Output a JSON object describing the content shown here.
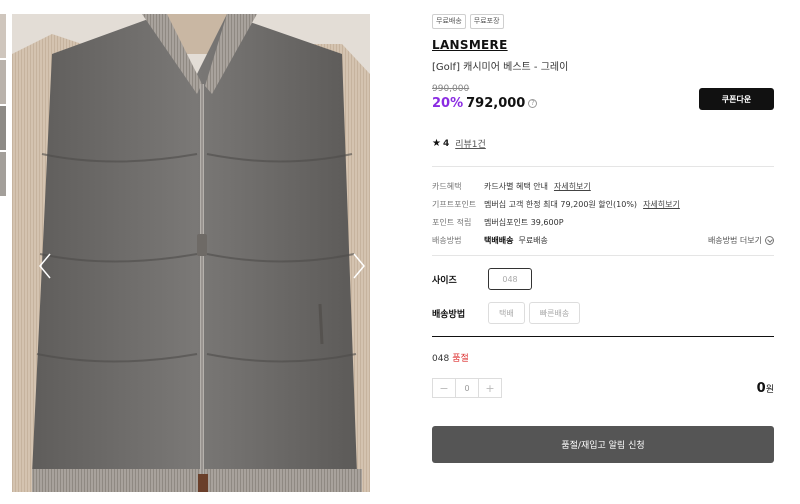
{
  "badges": [
    "무료배송",
    "무료포장"
  ],
  "brand": "LANSMERE",
  "product_name": "[Golf] 캐시미어 베스트 - 그레이",
  "price": {
    "original": "990,000",
    "discount": "20%",
    "sale": "792,000"
  },
  "coupon_button": "쿠폰다운",
  "rating": {
    "score": "4",
    "review_link": "리뷰1건"
  },
  "benefits": {
    "card": {
      "label": "카드혜택",
      "value": "카드사별 혜택 안내",
      "link": "자세히보기"
    },
    "gift_point": {
      "label": "기프트포인트",
      "value": "멤버십 고객 한정 최대 79,200원 할인(10%)",
      "link": "자세히보기"
    },
    "point": {
      "label": "포인트 적립",
      "value": "멤버십포인트 39,600P"
    },
    "shipping": {
      "label": "배송방법",
      "method": "택배배송",
      "fee": "무료배송",
      "more": "배송방법 더보기"
    }
  },
  "options": {
    "size_label": "사이즈",
    "size_value": "048",
    "delivery_label": "배송방법",
    "delivery_options": [
      "택배",
      "빠른배송"
    ]
  },
  "selection": {
    "item": "048",
    "status": "품절",
    "quantity": "0",
    "total": "0",
    "total_unit": "원"
  },
  "notify_button": "품절/재입고 알림 신청",
  "colors": {
    "discount": "#8a2be2",
    "soldout": "#dd3333",
    "button_dark": "#111111",
    "notify_bg": "#555555"
  }
}
